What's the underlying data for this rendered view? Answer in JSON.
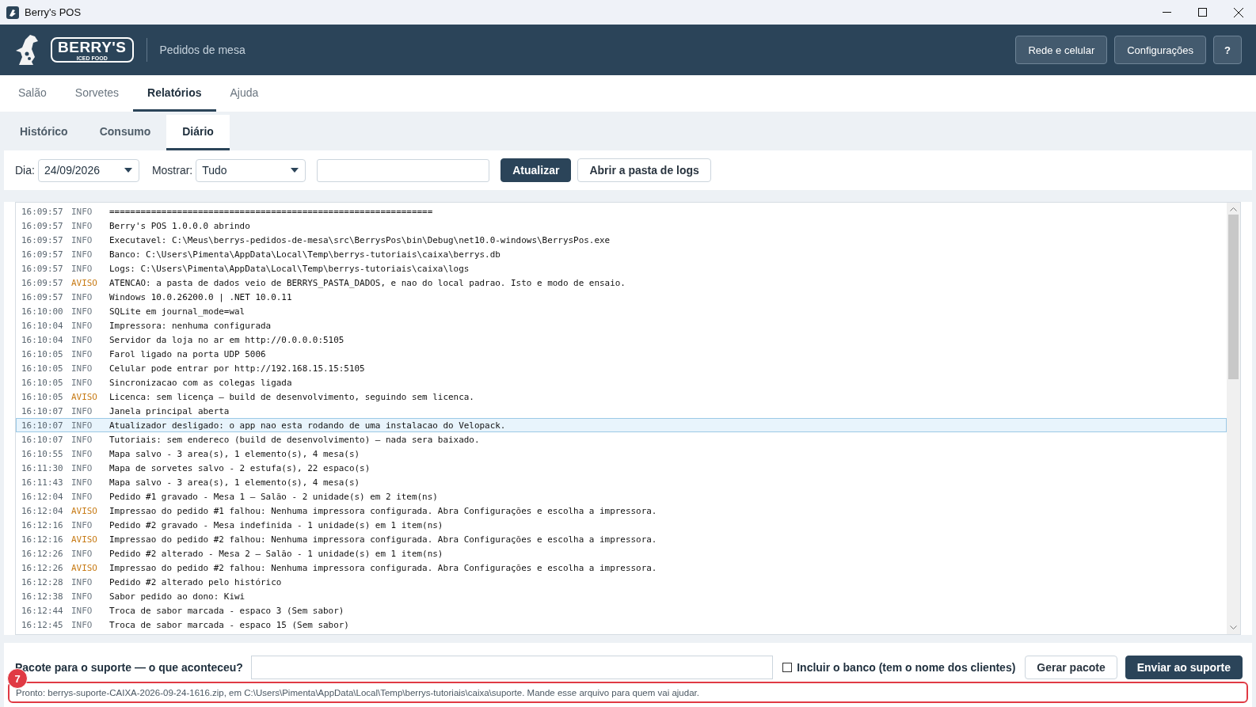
{
  "window": {
    "title": "Berry's POS"
  },
  "header": {
    "logo_text": "BERRY'S",
    "logo_subtext": "ICED FOOD",
    "subtitle": "Pedidos de mesa",
    "buttons": [
      "Rede e celular",
      "Configurações",
      "?"
    ]
  },
  "tabs": [
    {
      "label": "Salão",
      "selected": false
    },
    {
      "label": "Sorvetes",
      "selected": false
    },
    {
      "label": "Relatórios",
      "selected": true
    },
    {
      "label": "Ajuda",
      "selected": false
    }
  ],
  "subtabs": [
    {
      "label": "Histórico",
      "selected": false
    },
    {
      "label": "Consumo",
      "selected": false
    },
    {
      "label": "Diário",
      "selected": true
    }
  ],
  "toolbar": {
    "day_label": "Dia:",
    "day_value": "24/09/2026",
    "show_label": "Mostrar:",
    "show_value": "Tudo",
    "refresh_button": "Atualizar",
    "open_logs_button": "Abrir a pasta de logs"
  },
  "log": [
    {
      "time": "16:09:57",
      "severity": "INFO",
      "kind": "info",
      "message": "==============================================================",
      "selected": false
    },
    {
      "time": "16:09:57",
      "severity": "INFO",
      "kind": "info",
      "message": "Berry's POS 1.0.0.0 abrindo",
      "selected": false
    },
    {
      "time": "16:09:57",
      "severity": "INFO",
      "kind": "info",
      "message": "Executavel: C:\\Meus\\berrys-pedidos-de-mesa\\src\\BerrysPos\\bin\\Debug\\net10.0-windows\\BerrysPos.exe",
      "selected": false
    },
    {
      "time": "16:09:57",
      "severity": "INFO",
      "kind": "info",
      "message": "Banco: C:\\Users\\Pimenta\\AppData\\Local\\Temp\\berrys-tutoriais\\caixa\\berrys.db",
      "selected": false
    },
    {
      "time": "16:09:57",
      "severity": "INFO",
      "kind": "info",
      "message": "Logs: C:\\Users\\Pimenta\\AppData\\Local\\Temp\\berrys-tutoriais\\caixa\\logs",
      "selected": false
    },
    {
      "time": "16:09:57",
      "severity": "AVISO",
      "kind": "warn",
      "message": "ATENCAO: a pasta de dados veio de BERRYS_PASTA_DADOS, e nao do local padrao. Isto e modo de ensaio.",
      "selected": false
    },
    {
      "time": "16:09:57",
      "severity": "INFO",
      "kind": "info",
      "message": "Windows 10.0.26200.0 | .NET 10.0.11",
      "selected": false
    },
    {
      "time": "16:10:00",
      "severity": "INFO",
      "kind": "info",
      "message": "SQLite em journal_mode=wal",
      "selected": false
    },
    {
      "time": "16:10:04",
      "severity": "INFO",
      "kind": "info",
      "message": "Impressora: nenhuma configurada",
      "selected": false
    },
    {
      "time": "16:10:04",
      "severity": "INFO",
      "kind": "info",
      "message": "Servidor da loja no ar em http://0.0.0.0:5105",
      "selected": false
    },
    {
      "time": "16:10:05",
      "severity": "INFO",
      "kind": "info",
      "message": "Farol ligado na porta UDP 5006",
      "selected": false
    },
    {
      "time": "16:10:05",
      "severity": "INFO",
      "kind": "info",
      "message": "Celular pode entrar por http://192.168.15.15:5105",
      "selected": false
    },
    {
      "time": "16:10:05",
      "severity": "INFO",
      "kind": "info",
      "message": "Sincronizacao com as colegas ligada",
      "selected": false
    },
    {
      "time": "16:10:05",
      "severity": "AVISO",
      "kind": "warn",
      "message": "Licenca: sem licença — build de desenvolvimento, seguindo sem licenca.",
      "selected": false
    },
    {
      "time": "16:10:07",
      "severity": "INFO",
      "kind": "info",
      "message": "Janela principal aberta",
      "selected": false
    },
    {
      "time": "16:10:07",
      "severity": "INFO",
      "kind": "info",
      "message": "Atualizador desligado: o app nao esta rodando de uma instalacao do Velopack.",
      "selected": true
    },
    {
      "time": "16:10:07",
      "severity": "INFO",
      "kind": "info",
      "message": "Tutoriais: sem endereco (build de desenvolvimento) — nada sera baixado.",
      "selected": false
    },
    {
      "time": "16:10:55",
      "severity": "INFO",
      "kind": "info",
      "message": "Mapa salvo - 3 area(s), 1 elemento(s), 4 mesa(s)",
      "selected": false
    },
    {
      "time": "16:11:30",
      "severity": "INFO",
      "kind": "info",
      "message": "Mapa de sorvetes salvo - 2 estufa(s), 22 espaco(s)",
      "selected": false
    },
    {
      "time": "16:11:43",
      "severity": "INFO",
      "kind": "info",
      "message": "Mapa salvo - 3 area(s), 1 elemento(s), 4 mesa(s)",
      "selected": false
    },
    {
      "time": "16:12:04",
      "severity": "INFO",
      "kind": "info",
      "message": "Pedido #1 gravado - Mesa 1 — Salão - 2 unidade(s) em 2 item(ns)",
      "selected": false
    },
    {
      "time": "16:12:04",
      "severity": "AVISO",
      "kind": "warn",
      "message": "Impressao do pedido #1 falhou: Nenhuma impressora configurada. Abra Configurações e escolha a impressora.",
      "selected": false
    },
    {
      "time": "16:12:16",
      "severity": "INFO",
      "kind": "info",
      "message": "Pedido #2 gravado - Mesa indefinida - 1 unidade(s) em 1 item(ns)",
      "selected": false
    },
    {
      "time": "16:12:16",
      "severity": "AVISO",
      "kind": "warn",
      "message": "Impressao do pedido #2 falhou: Nenhuma impressora configurada. Abra Configurações e escolha a impressora.",
      "selected": false
    },
    {
      "time": "16:12:26",
      "severity": "INFO",
      "kind": "info",
      "message": "Pedido #2 alterado - Mesa 2 — Salão - 1 unidade(s) em 1 item(ns)",
      "selected": false
    },
    {
      "time": "16:12:26",
      "severity": "AVISO",
      "kind": "warn",
      "message": "Impressao do pedido #2 falhou: Nenhuma impressora configurada. Abra Configurações e escolha a impressora.",
      "selected": false
    },
    {
      "time": "16:12:28",
      "severity": "INFO",
      "kind": "info",
      "message": "Pedido #2 alterado pelo histórico",
      "selected": false
    },
    {
      "time": "16:12:38",
      "severity": "INFO",
      "kind": "info",
      "message": "Sabor pedido ao dono: Kiwi",
      "selected": false
    },
    {
      "time": "16:12:44",
      "severity": "INFO",
      "kind": "info",
      "message": "Troca de sabor marcada - espaco 3 (Sem sabor)",
      "selected": false
    },
    {
      "time": "16:12:45",
      "severity": "INFO",
      "kind": "info",
      "message": "Troca de sabor marcada - espaco 15 (Sem sabor)",
      "selected": false
    }
  ],
  "support": {
    "label": "Pacote para o suporte — o que aconteceu?",
    "include_db": {
      "label": "Incluir o banco (tem o nome dos clientes)",
      "checked": false
    },
    "generate_button": "Gerar pacote",
    "send_button": "Enviar ao suporte",
    "status": "Pronto: berrys-suporte-CAIXA-2026-09-24-1616.zip, em C:\\Users\\Pimenta\\AppData\\Local\\Temp\\berrys-tutoriais\\caixa\\suporte. Mande esse arquivo para quem vai ajudar."
  },
  "annotation": {
    "number": "7"
  }
}
